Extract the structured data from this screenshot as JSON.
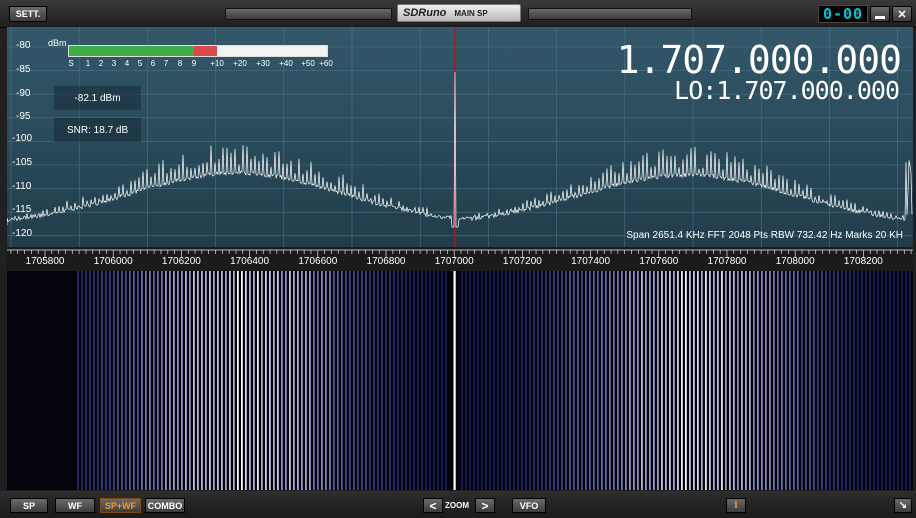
{
  "window": {
    "settings_label": "SETT.",
    "logo_text": "SDRuno",
    "panel_name": "MAIN SP",
    "clock": "0-00"
  },
  "spectrum": {
    "db_unit": "dBm",
    "db_labels": [
      "-80",
      "-85",
      "-90",
      "-95",
      "-100",
      "-105",
      "-110",
      "-115",
      "-120"
    ],
    "smeter_labels": [
      "S",
      "1",
      "2",
      "3",
      "4",
      "5",
      "6",
      "7",
      "8",
      "9",
      "+10",
      "+20",
      "+30",
      "+40",
      "+50",
      "+60"
    ],
    "smeter_fill_green": 0.48,
    "smeter_fill_red": 0.57,
    "level_readout": "-82.1 dBm",
    "snr_readout": "SNR: 18.7 dB",
    "main_frequency": "1.707.000.000",
    "lo_frequency": "LO:1.707.000.000",
    "info": "Span 2651.4 KHz  FFT 2048 Pts  RBW 732.42 Hz  Marks 20 KH"
  },
  "axis": {
    "ticks": [
      "1705800",
      "1706000",
      "1706200",
      "1706400",
      "1706600",
      "1706800",
      "1707000",
      "1707200",
      "1707400",
      "1707600",
      "1707800",
      "1708000",
      "1708200"
    ]
  },
  "toolbar": {
    "sp": "SP",
    "wf": "WF",
    "sp_wf": "SP+WF",
    "combo": "COMBO",
    "zoom_left": "<",
    "zoom": "ZOOM",
    "zoom_right": ">",
    "vfo": "VFO",
    "info": "i",
    "resize": "↘"
  },
  "colors": {
    "accent_orange": "#ff9a1a",
    "clock_cyan": "#00c6d8",
    "center_line": "#b01818",
    "waterfall_line": "#6a78ff"
  }
}
